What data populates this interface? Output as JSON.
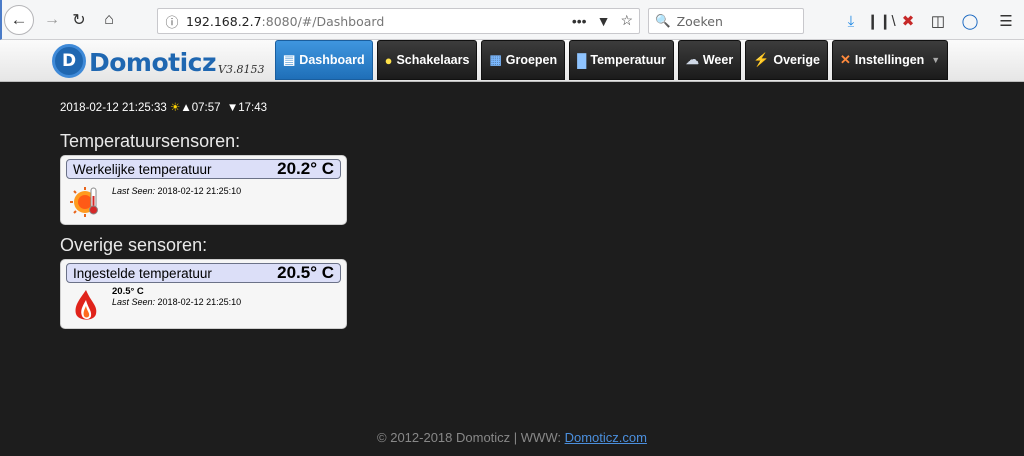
{
  "browser": {
    "url_host": "192.168.2.7",
    "url_rest": ":8080/#/Dashboard",
    "search_placeholder": "Zoeken"
  },
  "app": {
    "logo_text": "Domoticz",
    "version": "V3.8153",
    "menu": [
      {
        "label": "Dashboard",
        "icon": "dashboard-icon",
        "active": true
      },
      {
        "label": "Schakelaars",
        "icon": "bulb-icon"
      },
      {
        "label": "Groepen",
        "icon": "groups-icon"
      },
      {
        "label": "Temperatuur",
        "icon": "thermometer-icon"
      },
      {
        "label": "Weer",
        "icon": "weather-icon"
      },
      {
        "label": "Overige",
        "icon": "lightning-icon"
      },
      {
        "label": "Instellingen",
        "icon": "tools-icon"
      }
    ]
  },
  "dashboard": {
    "datetime": "2018-02-12 21:25:33",
    "sunrise": "07:57",
    "sunset": "17:43",
    "sections": [
      {
        "title": "Temperatuursensoren:",
        "devices": [
          {
            "name": "Werkelijke temperatuur",
            "value": "20.2° C",
            "last_seen_label": "Last Seen:",
            "last_seen": "2018-02-12 21:25:10",
            "icon": "temperature-sun-icon"
          }
        ]
      },
      {
        "title": "Overige sensoren:",
        "devices": [
          {
            "name": "Ingestelde temperatuur",
            "value": "20.5° C",
            "status": "20.5° C",
            "last_seen_label": "Last Seen:",
            "last_seen": "2018-02-12 21:25:10",
            "icon": "flame-icon"
          }
        ]
      }
    ]
  },
  "footer": {
    "text": "© 2012-2018 Domoticz | WWW: ",
    "link": "Domoticz.com"
  }
}
